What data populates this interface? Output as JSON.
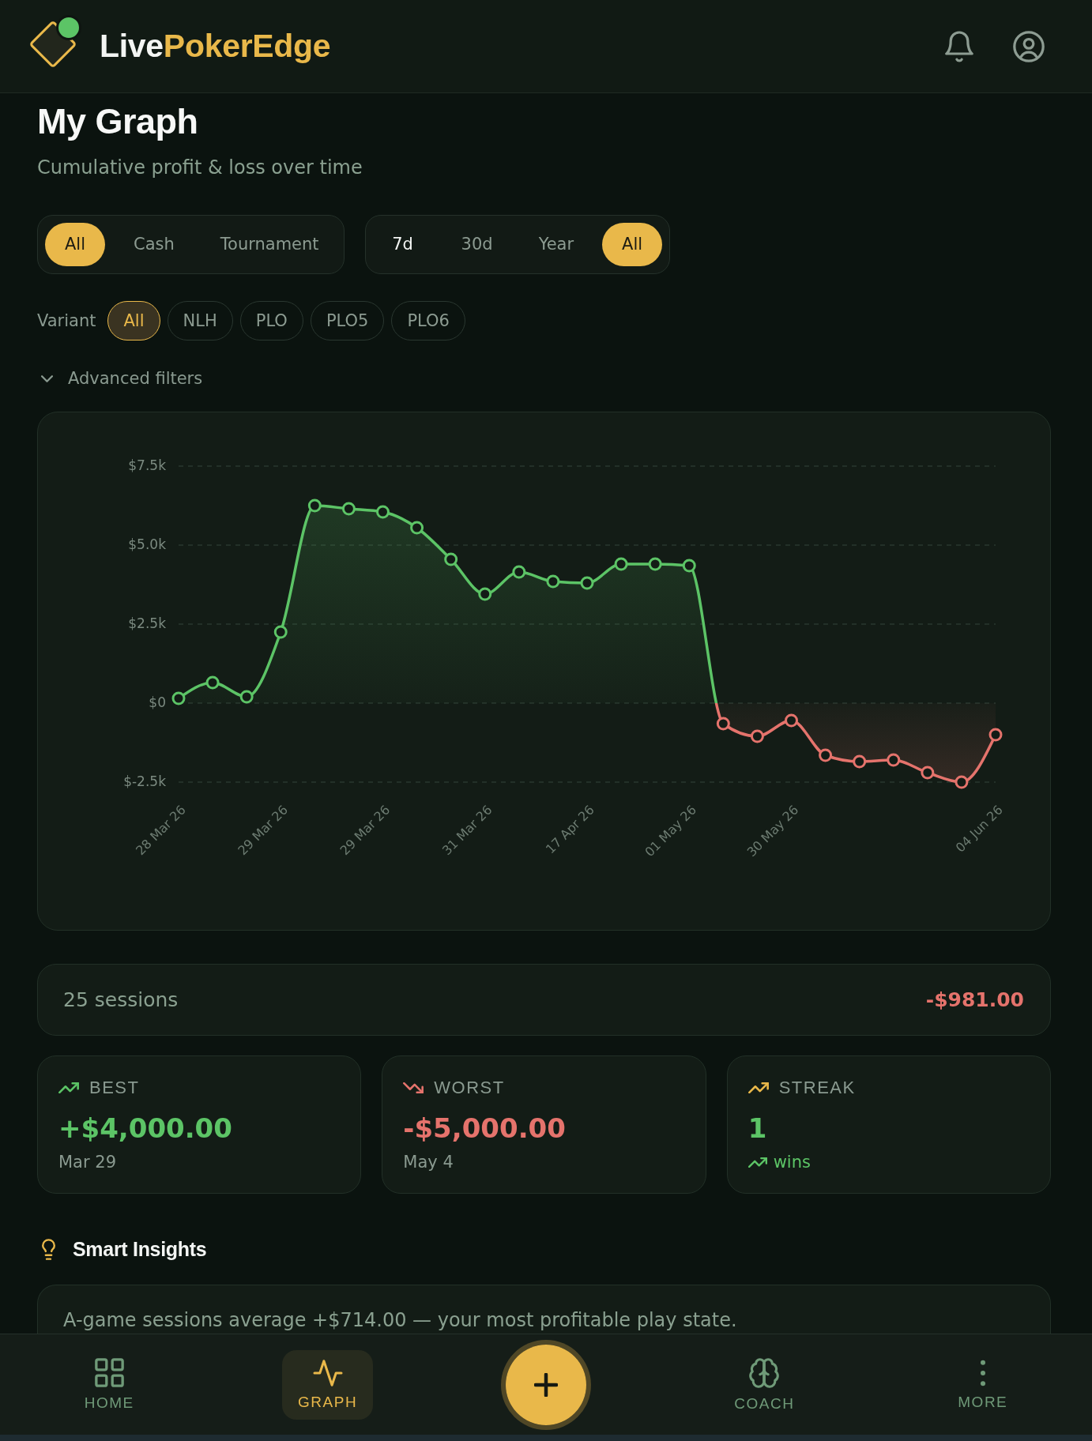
{
  "header": {
    "brand_start": "Live",
    "brand_end": "PokerEdge"
  },
  "page": {
    "title": "My Graph",
    "subtitle": "Cumulative profit & loss over time"
  },
  "game_type_filter": [
    {
      "label": "All",
      "selected": true
    },
    {
      "label": "Cash",
      "selected": false
    },
    {
      "label": "Tournament",
      "selected": false
    }
  ],
  "period_filter": [
    {
      "label": "7d",
      "selected": false,
      "focused": true
    },
    {
      "label": "30d",
      "selected": false,
      "focused": false
    },
    {
      "label": "Year",
      "selected": false,
      "focused": false
    },
    {
      "label": "All",
      "selected": true,
      "focused": false
    }
  ],
  "variant_filter": {
    "label": "Variant",
    "options": [
      {
        "label": "All",
        "selected": true
      },
      {
        "label": "NLH",
        "selected": false
      },
      {
        "label": "PLO",
        "selected": false
      },
      {
        "label": "PLO5",
        "selected": false
      },
      {
        "label": "PLO6",
        "selected": false
      }
    ]
  },
  "advanced_filters": {
    "label": "Advanced filters",
    "expanded": false
  },
  "chart": {
    "chart_data": {
      "type": "area",
      "categories": [
        "28 Mar 26",
        null,
        null,
        "29 Mar 26",
        null,
        null,
        "29 Mar 26",
        null,
        null,
        "31 Mar 26",
        null,
        null,
        "17 Apr 26",
        null,
        null,
        "01 May 26",
        null,
        null,
        "30 May 26",
        null,
        null,
        null,
        null,
        null,
        "04 Jun 26"
      ],
      "series": [
        {
          "color": "#5cc466",
          "values": [
            150,
            650,
            200,
            2250,
            6250,
            6150,
            6050,
            5550,
            4550,
            3450,
            4150,
            3850,
            3800,
            4400,
            4400,
            4350,
            -650,
            -1050,
            -550,
            -1650,
            -1850,
            -1800,
            -2200,
            -2500,
            -1000
          ]
        }
      ],
      "ylim": [
        -2500,
        7500
      ],
      "yticks": [
        {
          "value": 7500,
          "label": "$7.5k"
        },
        {
          "value": 5000,
          "label": "$5.0k"
        },
        {
          "value": 2500,
          "label": "$2.5k"
        },
        {
          "value": 0,
          "label": "$0"
        },
        {
          "value": -2500,
          "label": "$-2.5k"
        }
      ],
      "grid": true
    }
  },
  "summary": {
    "sessions": "25 sessions",
    "total": "-$981.00",
    "positive": false
  },
  "stats": [
    {
      "kind": "best",
      "label": "BEST",
      "value": "+$4,000.00",
      "caption": "Mar 29"
    },
    {
      "kind": "worst",
      "label": "WORST",
      "value": "-$5,000.00",
      "caption": "May 4"
    },
    {
      "kind": "streak",
      "label": "STREAK",
      "value": "1",
      "caption": "wins"
    }
  ],
  "insights": {
    "title": "Smart Insights",
    "items": [
      "A-game sessions average +$714.00 — your most profitable play state."
    ]
  },
  "bottom_nav": [
    {
      "kind": "tab",
      "label": "HOME",
      "selected": false
    },
    {
      "kind": "tab",
      "label": "GRAPH",
      "selected": true
    },
    {
      "kind": "add"
    },
    {
      "kind": "tab",
      "label": "COACH",
      "selected": false
    },
    {
      "kind": "tab",
      "label": "MORE",
      "selected": false
    }
  ]
}
